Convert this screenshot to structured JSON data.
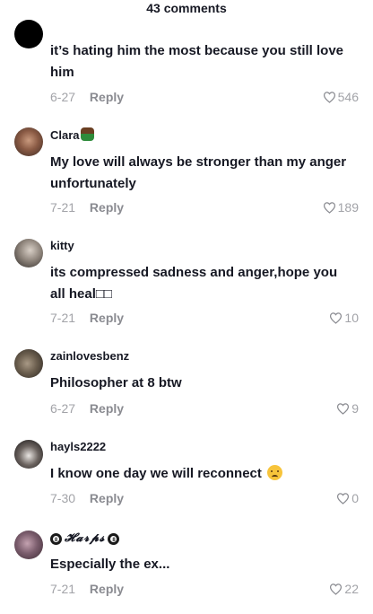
{
  "header": {
    "title": "43 comments"
  },
  "comments": [
    {
      "username": "",
      "text": "it’s hating him the most because you still love him",
      "date": "6-27",
      "reply_label": "Reply",
      "likes": "546"
    },
    {
      "username": "Clara",
      "text": "My love will always be stronger than my anger unfortunately",
      "date": "7-21",
      "reply_label": "Reply",
      "likes": "189"
    },
    {
      "username": "kitty",
      "text": "its compressed sadness and anger,hope you all heal",
      "text_suffix": "□□",
      "date": "7-21",
      "reply_label": "Reply",
      "likes": "10"
    },
    {
      "username": "zainlovesbenz",
      "text": "Philosopher at 8 btw",
      "date": "6-27",
      "reply_label": "Reply",
      "likes": "9"
    },
    {
      "username": "hayls2222",
      "text": "I know one day we will reconnect",
      "date": "7-30",
      "reply_label": "Reply",
      "likes": "0"
    },
    {
      "username": "𝓗𝓪𝓻𝓹𝓼",
      "orb_label": "8",
      "text": "Especially the ex...",
      "date": "7-21",
      "reply_label": "Reply",
      "likes": "22"
    }
  ],
  "icons": {
    "like": "heart-outline-icon",
    "username_emoji": "person-emoji-icon",
    "sad_emoji": "sad-face-emoji-icon",
    "orb": "eight-ball-icon"
  },
  "colors": {
    "primary_text": "#161823",
    "secondary_text": "#a2a3a8",
    "background": "#ffffff"
  }
}
